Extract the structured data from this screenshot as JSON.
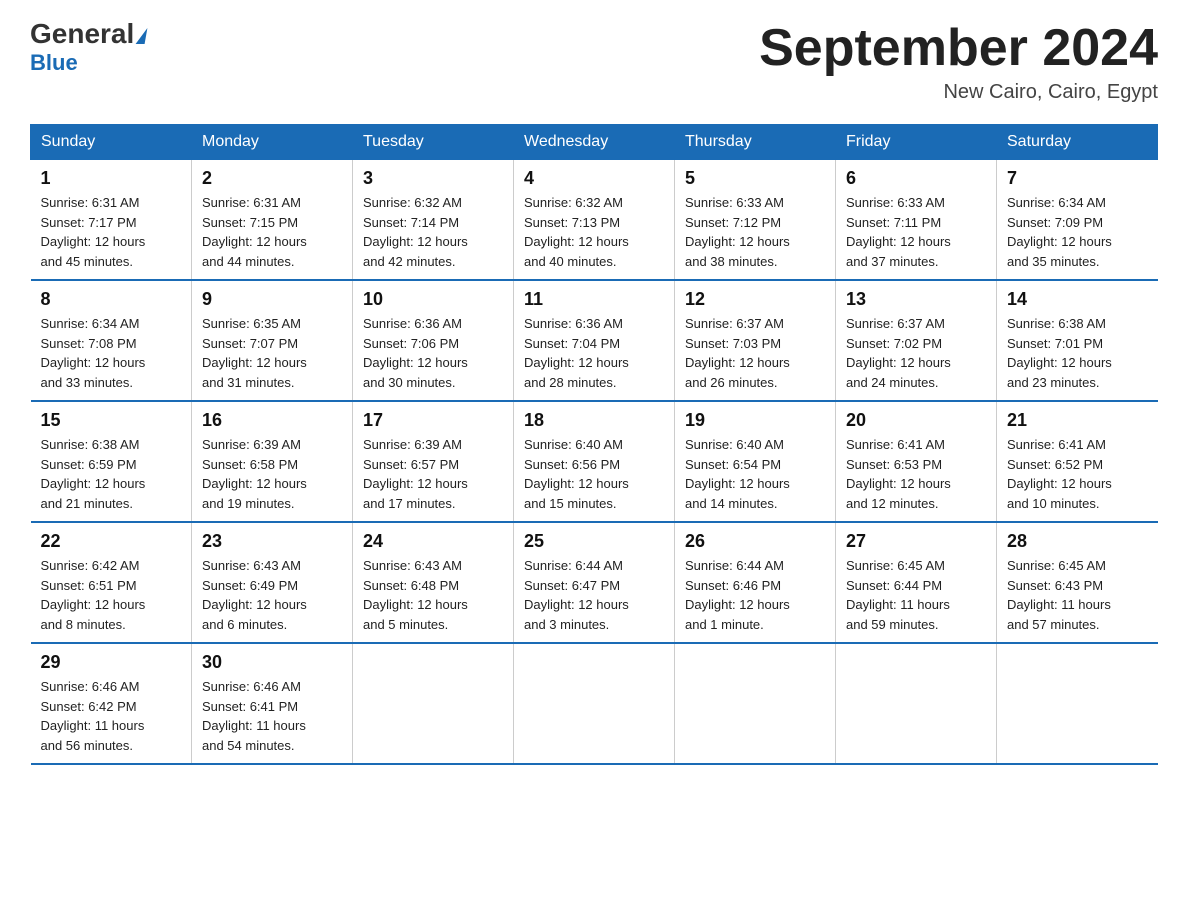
{
  "header": {
    "logo_general": "General",
    "logo_blue": "Blue",
    "month_title": "September 2024",
    "location": "New Cairo, Cairo, Egypt"
  },
  "days_of_week": [
    "Sunday",
    "Monday",
    "Tuesday",
    "Wednesday",
    "Thursday",
    "Friday",
    "Saturday"
  ],
  "weeks": [
    [
      {
        "num": "1",
        "info": "Sunrise: 6:31 AM\nSunset: 7:17 PM\nDaylight: 12 hours\nand 45 minutes."
      },
      {
        "num": "2",
        "info": "Sunrise: 6:31 AM\nSunset: 7:15 PM\nDaylight: 12 hours\nand 44 minutes."
      },
      {
        "num": "3",
        "info": "Sunrise: 6:32 AM\nSunset: 7:14 PM\nDaylight: 12 hours\nand 42 minutes."
      },
      {
        "num": "4",
        "info": "Sunrise: 6:32 AM\nSunset: 7:13 PM\nDaylight: 12 hours\nand 40 minutes."
      },
      {
        "num": "5",
        "info": "Sunrise: 6:33 AM\nSunset: 7:12 PM\nDaylight: 12 hours\nand 38 minutes."
      },
      {
        "num": "6",
        "info": "Sunrise: 6:33 AM\nSunset: 7:11 PM\nDaylight: 12 hours\nand 37 minutes."
      },
      {
        "num": "7",
        "info": "Sunrise: 6:34 AM\nSunset: 7:09 PM\nDaylight: 12 hours\nand 35 minutes."
      }
    ],
    [
      {
        "num": "8",
        "info": "Sunrise: 6:34 AM\nSunset: 7:08 PM\nDaylight: 12 hours\nand 33 minutes."
      },
      {
        "num": "9",
        "info": "Sunrise: 6:35 AM\nSunset: 7:07 PM\nDaylight: 12 hours\nand 31 minutes."
      },
      {
        "num": "10",
        "info": "Sunrise: 6:36 AM\nSunset: 7:06 PM\nDaylight: 12 hours\nand 30 minutes."
      },
      {
        "num": "11",
        "info": "Sunrise: 6:36 AM\nSunset: 7:04 PM\nDaylight: 12 hours\nand 28 minutes."
      },
      {
        "num": "12",
        "info": "Sunrise: 6:37 AM\nSunset: 7:03 PM\nDaylight: 12 hours\nand 26 minutes."
      },
      {
        "num": "13",
        "info": "Sunrise: 6:37 AM\nSunset: 7:02 PM\nDaylight: 12 hours\nand 24 minutes."
      },
      {
        "num": "14",
        "info": "Sunrise: 6:38 AM\nSunset: 7:01 PM\nDaylight: 12 hours\nand 23 minutes."
      }
    ],
    [
      {
        "num": "15",
        "info": "Sunrise: 6:38 AM\nSunset: 6:59 PM\nDaylight: 12 hours\nand 21 minutes."
      },
      {
        "num": "16",
        "info": "Sunrise: 6:39 AM\nSunset: 6:58 PM\nDaylight: 12 hours\nand 19 minutes."
      },
      {
        "num": "17",
        "info": "Sunrise: 6:39 AM\nSunset: 6:57 PM\nDaylight: 12 hours\nand 17 minutes."
      },
      {
        "num": "18",
        "info": "Sunrise: 6:40 AM\nSunset: 6:56 PM\nDaylight: 12 hours\nand 15 minutes."
      },
      {
        "num": "19",
        "info": "Sunrise: 6:40 AM\nSunset: 6:54 PM\nDaylight: 12 hours\nand 14 minutes."
      },
      {
        "num": "20",
        "info": "Sunrise: 6:41 AM\nSunset: 6:53 PM\nDaylight: 12 hours\nand 12 minutes."
      },
      {
        "num": "21",
        "info": "Sunrise: 6:41 AM\nSunset: 6:52 PM\nDaylight: 12 hours\nand 10 minutes."
      }
    ],
    [
      {
        "num": "22",
        "info": "Sunrise: 6:42 AM\nSunset: 6:51 PM\nDaylight: 12 hours\nand 8 minutes."
      },
      {
        "num": "23",
        "info": "Sunrise: 6:43 AM\nSunset: 6:49 PM\nDaylight: 12 hours\nand 6 minutes."
      },
      {
        "num": "24",
        "info": "Sunrise: 6:43 AM\nSunset: 6:48 PM\nDaylight: 12 hours\nand 5 minutes."
      },
      {
        "num": "25",
        "info": "Sunrise: 6:44 AM\nSunset: 6:47 PM\nDaylight: 12 hours\nand 3 minutes."
      },
      {
        "num": "26",
        "info": "Sunrise: 6:44 AM\nSunset: 6:46 PM\nDaylight: 12 hours\nand 1 minute."
      },
      {
        "num": "27",
        "info": "Sunrise: 6:45 AM\nSunset: 6:44 PM\nDaylight: 11 hours\nand 59 minutes."
      },
      {
        "num": "28",
        "info": "Sunrise: 6:45 AM\nSunset: 6:43 PM\nDaylight: 11 hours\nand 57 minutes."
      }
    ],
    [
      {
        "num": "29",
        "info": "Sunrise: 6:46 AM\nSunset: 6:42 PM\nDaylight: 11 hours\nand 56 minutes."
      },
      {
        "num": "30",
        "info": "Sunrise: 6:46 AM\nSunset: 6:41 PM\nDaylight: 11 hours\nand 54 minutes."
      },
      {
        "num": "",
        "info": ""
      },
      {
        "num": "",
        "info": ""
      },
      {
        "num": "",
        "info": ""
      },
      {
        "num": "",
        "info": ""
      },
      {
        "num": "",
        "info": ""
      }
    ]
  ]
}
